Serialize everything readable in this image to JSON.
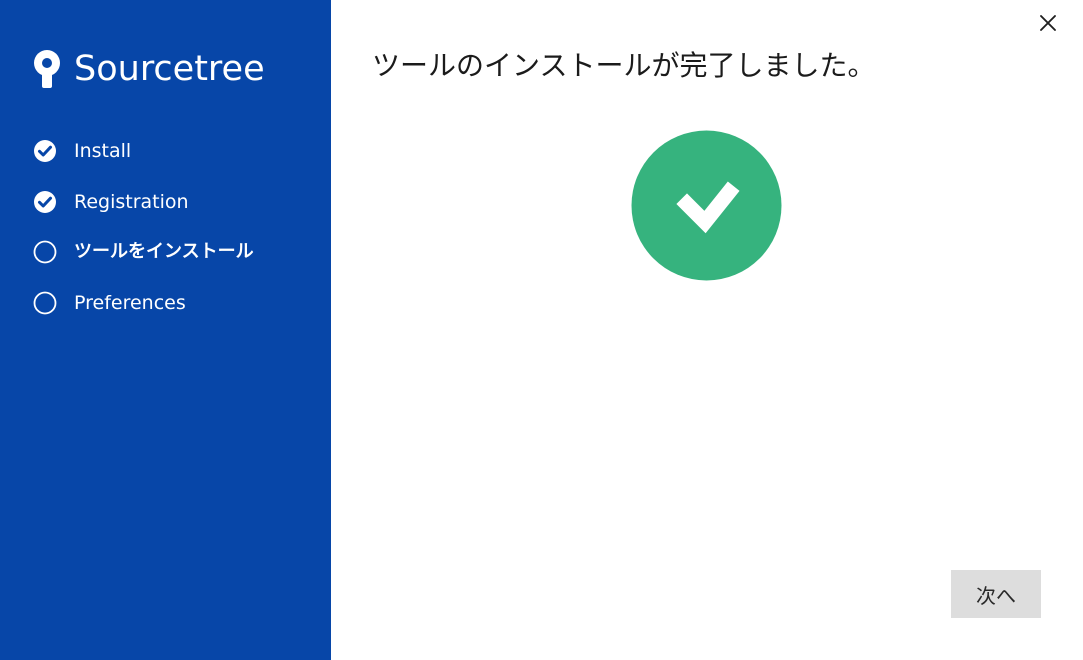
{
  "brand": {
    "name": "Sourcetree",
    "icon": "sourcetree-logo-icon"
  },
  "steps": [
    {
      "label": "Install",
      "status": "completed",
      "icon": "check-circle-icon"
    },
    {
      "label": "Registration",
      "status": "completed",
      "icon": "check-circle-icon"
    },
    {
      "label": "ツールをインストール",
      "status": "current",
      "icon": "empty-circle-icon"
    },
    {
      "label": "Preferences",
      "status": "pending",
      "icon": "empty-circle-icon"
    }
  ],
  "content": {
    "title": "ツールのインストールが完了しました。",
    "status_icon": "success-check-icon"
  },
  "buttons": {
    "close_icon": "close-icon",
    "next_label": "次へ"
  },
  "colors": {
    "sidebar": "#0746a8",
    "success": "#36b37e",
    "next_button": "#dddddd"
  }
}
